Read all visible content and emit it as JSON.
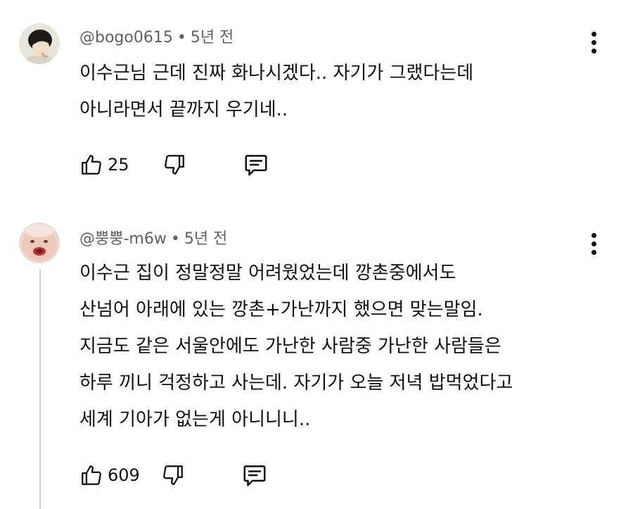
{
  "comments": [
    {
      "author": "@bogo0615",
      "separator": "•",
      "time": "5년 전",
      "lines": [
        "이수근님 근데 진짜 화나시겠다.. 자기가 그랬다는데",
        "아니라면서 끝까지 우기네.."
      ],
      "likes": "25",
      "avatar_icon": "profile-photo-dark-hair-person"
    },
    {
      "author": "@뿡뿡-m6w",
      "separator": "•",
      "time": "5년 전",
      "lines": [
        "이수근 집이 정말정말 어려웠었는데 깡촌중에서도",
        "산넘어 아래에 있는 깡촌+가난까지 했으면 맞는말임.",
        "지금도 같은 서울안에도 가난한 사람중  가난한 사람들은",
        "하루 끼니 걱정하고 사는데. 자기가 오늘 저녁 밥먹었다고",
        "세계 기아가 없는게 아니니니.."
      ],
      "likes": "609",
      "avatar_icon": "profile-photo-baby-face"
    }
  ],
  "icons": {
    "like": "thumbs-up-icon",
    "dislike": "thumbs-down-icon",
    "reply": "reply-comment-icon",
    "more": "more-vertical-icon"
  },
  "colors": {
    "meta_text": "#606060",
    "body_text": "#0f0f0f",
    "thread_line": "#cfcfcf"
  }
}
